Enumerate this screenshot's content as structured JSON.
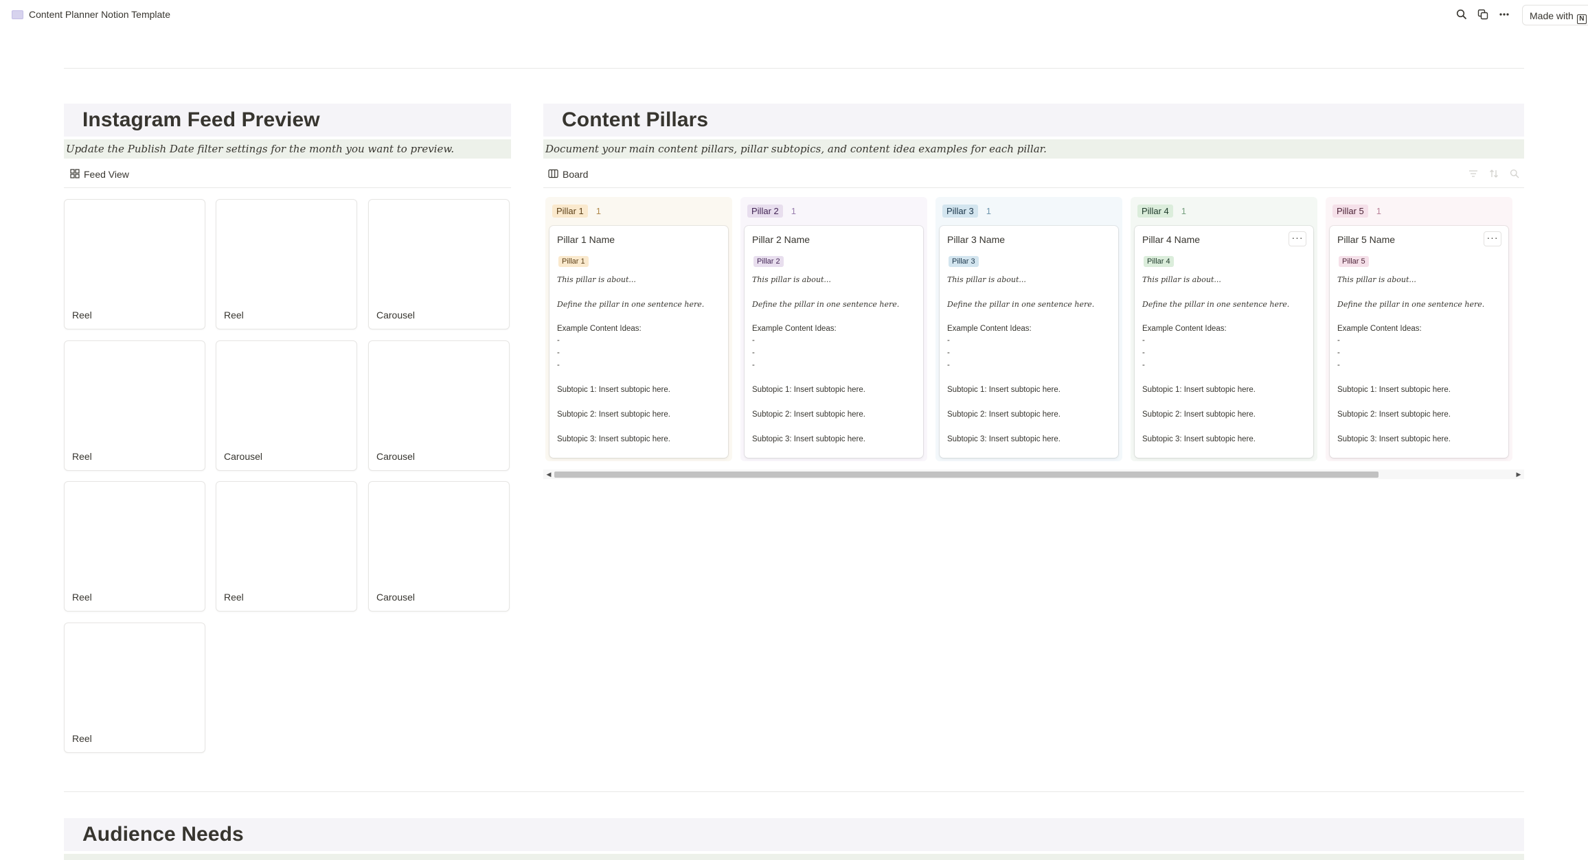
{
  "topbar": {
    "page_title": "Content Planner Notion Template",
    "search_icon": "search-icon",
    "duplicate_icon": "duplicate-icon",
    "more_icon": "more-icon",
    "made_with_label": "Made with"
  },
  "feed": {
    "heading": "Instagram Feed Preview",
    "description": "Update the Publish Date filter settings for the month you want to preview.",
    "view_label": "Feed View",
    "cards": [
      "Reel",
      "Reel",
      "Carousel",
      "Reel",
      "Carousel",
      "Carousel",
      "Reel",
      "Reel",
      "Carousel",
      "Reel"
    ]
  },
  "pillars": {
    "heading": "Content Pillars",
    "description": "Document your main content pillars, pillar subtopics, and content idea examples for each pillar.",
    "view_label": "Board",
    "columns": [
      {
        "tag": "Pillar 1",
        "count": "1",
        "name": "Pillar 1 Name",
        "about": "This pillar is about...",
        "define": "Define the pillar in one sentence here.",
        "ideas_label": "Example Content Ideas:",
        "dash": "-",
        "sub1": "Subtopic 1: Insert subtopic here.",
        "sub2": "Subtopic 2: Insert subtopic here.",
        "sub3": "Subtopic 3: Insert subtopic here.",
        "col_bg": "#fbf8f1",
        "tag_bg": "#fae9cd",
        "tag_fg": "#5b3f17",
        "count_fg": "#b0894a"
      },
      {
        "tag": "Pillar 2",
        "count": "1",
        "name": "Pillar 2 Name",
        "about": "This pillar is about...",
        "define": "Define the pillar in one sentence here.",
        "ideas_label": "Example Content Ideas:",
        "dash": "-",
        "sub1": "Subtopic 1: Insert subtopic here.",
        "sub2": "Subtopic 2: Insert subtopic here.",
        "sub3": "Subtopic 3: Insert subtopic here.",
        "col_bg": "#f9f6fb",
        "tag_bg": "#e8deee",
        "tag_fg": "#412454",
        "count_fg": "#9a7fae"
      },
      {
        "tag": "Pillar 3",
        "count": "1",
        "name": "Pillar 3 Name",
        "about": "This pillar is about...",
        "define": "Define the pillar in one sentence here.",
        "ideas_label": "Example Content Ideas:",
        "dash": "-",
        "sub1": "Subtopic 1: Insert subtopic here.",
        "sub2": "Subtopic 2: Insert subtopic here.",
        "sub3": "Subtopic 3: Insert subtopic here.",
        "col_bg": "#f3f8fb",
        "tag_bg": "#d3e5ef",
        "tag_fg": "#183347",
        "count_fg": "#6f96ae"
      },
      {
        "tag": "Pillar 4",
        "count": "1",
        "name": "Pillar 4 Name",
        "about": "This pillar is about...",
        "define": "Define the pillar in one sentence here.",
        "ideas_label": "Example Content Ideas:",
        "dash": "-",
        "sub1": "Subtopic 1: Insert subtopic here.",
        "sub2": "Subtopic 2: Insert subtopic here.",
        "sub3": "Subtopic 3: Insert subtopic here.",
        "col_bg": "#f4f8f4",
        "tag_bg": "#dbeddb",
        "tag_fg": "#1c3829",
        "count_fg": "#77a07f"
      },
      {
        "tag": "Pillar 5",
        "count": "1",
        "name": "Pillar 5 Name",
        "about": "This pillar is about...",
        "define": "Define the pillar in one sentence here.",
        "ideas_label": "Example Content Ideas:",
        "dash": "-",
        "sub1": "Subtopic 1: Insert subtopic here.",
        "sub2": "Subtopic 2: Insert subtopic here.",
        "sub3": "Subtopic 3: Insert subtopic here.",
        "col_bg": "#fcf5f7",
        "tag_bg": "#f5e0e9",
        "tag_fg": "#4c2337",
        "count_fg": "#b98399"
      }
    ]
  },
  "audience": {
    "heading": "Audience Needs"
  }
}
